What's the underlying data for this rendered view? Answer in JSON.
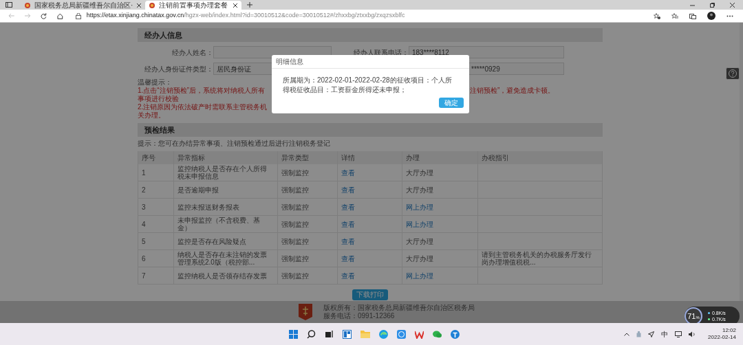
{
  "browser": {
    "tabs": [
      {
        "title": "国家税务总局新疆维吾尔自治区·",
        "selected": false
      },
      {
        "title": "注销前置事项办理套餐",
        "selected": true
      }
    ],
    "url": {
      "host": "https://etax.xinjiang.chinatax.gov.cn",
      "path": "/hgzx-web/index.html?id=30010512&code=30010512#/zhxxbg/ztxxbg/zxqzsxblfc"
    }
  },
  "operator_section": {
    "title": "经办人信息",
    "rows": [
      [
        {
          "label": "经办人姓名："
        },
        {
          "label": "经办人联系电话：",
          "value": "183****8112"
        }
      ],
      [
        {
          "label": "经办人身份证件类型：",
          "value": "居民身份证"
        },
        {
          "value": "*****0929"
        }
      ]
    ]
  },
  "notes": {
    "title": "温馨提示：",
    "lines": [
      {
        "left": "1.点击“注销预检”后，系统将对纳税人所有事项进行校验",
        "right": "注销预检”，避免造成卡顿。"
      },
      {
        "left": "2.注销原因为依法破产时需联系主管税务机关办理。"
      }
    ]
  },
  "precheck_section": {
    "title": "预检结果",
    "hint": "提示：您可在办结异常事项、注销预检通过后进行注销税务登记",
    "columns": [
      "序号",
      "异常指标",
      "异常类型",
      "详情",
      "办理",
      "办税指引"
    ],
    "rows": [
      {
        "index": "1",
        "indicator": "监控纳税人是否存在个人所得税未申报信息",
        "type": "强制监控",
        "detail": "查看",
        "action": {
          "text": "大厅办理",
          "kind": "hall"
        }
      },
      {
        "index": "2",
        "indicator": "是否逾期申报",
        "type": "强制监控",
        "detail": "查看",
        "action": {
          "text": "大厅办理",
          "kind": "hall"
        }
      },
      {
        "index": "3",
        "indicator": "监控未报送财务报表",
        "type": "强制监控",
        "detail": "查看",
        "action": {
          "text": "网上办理",
          "kind": "online"
        }
      },
      {
        "index": "4",
        "indicator": "未申报监控（不含税费、基金）",
        "type": "强制监控",
        "detail": "查看",
        "action": {
          "text": "网上办理",
          "kind": "online"
        }
      },
      {
        "index": "5",
        "indicator": "监控是否存在风险疑点",
        "type": "强制监控",
        "detail": "查看",
        "action": {
          "text": "大厅办理",
          "kind": "hall"
        }
      },
      {
        "index": "6",
        "indicator": "纳税人是否存在未注销的发票管理系统2.0版（税控部...",
        "type": "强制监控",
        "detail": "查看",
        "action": {
          "text": "大厅办理",
          "kind": "hall"
        },
        "guide": "请到主管税务机关的办税服务厅发行岗办理增值税税..."
      },
      {
        "index": "7",
        "indicator": "监控纳税人是否领存结存发票",
        "type": "强制监控",
        "detail": "查看",
        "action": {
          "text": "网上办理",
          "kind": "online"
        }
      }
    ],
    "button": "下载打印"
  },
  "footer": {
    "copyright": "版权所有：国家税务总局新疆维吾尔自治区税务局",
    "phone": "服务电话：0991-12366"
  },
  "dialog": {
    "title": "明细信息",
    "message": "所属期为：2022-02-01-2022-02-28的征收项目：个人所得税征收品目：工资薪金所得还未申报；",
    "button": "确定"
  },
  "speed_widget": {
    "percent": "71",
    "unit": "%",
    "upload": "0.8K/s",
    "download": "0.7K/s"
  },
  "taskbar": {
    "ime": "中",
    "time": "12:02",
    "date": "2022-02-14"
  }
}
